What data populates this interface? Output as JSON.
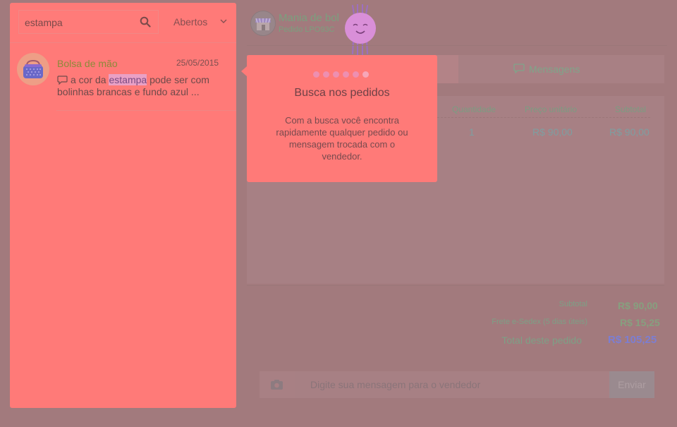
{
  "search": {
    "value": "estampa",
    "icon": "search-icon"
  },
  "filter": {
    "selected": "Abertos",
    "icon": "chevron-down-icon"
  },
  "orders": [
    {
      "title": "Bolsa de mão",
      "date": "25/05/2015",
      "message_before": "a cor da ",
      "message_highlight": "estampa",
      "message_after": " pode ser com bolinhas brancas e fundo azul  ..."
    }
  ],
  "shop": {
    "name": "Mania de bol",
    "order_code": "Pedido LPO93C"
  },
  "tabs": {
    "messages": "Mensagens"
  },
  "table": {
    "headers": [
      "Quantidade",
      "Preço unitário",
      "Subtotal"
    ],
    "row": [
      "1",
      "R$ 90,00",
      "R$ 90,00"
    ]
  },
  "summary": {
    "subtotal_label": "Subtotal",
    "subtotal_value": "R$ 90,00",
    "shipping_label": "Frete e-Sedex (5 dias úteis)",
    "shipping_value": "R$ 15,25",
    "total_label": "Total deste pedido",
    "total_value": "R$ 105,25"
  },
  "composer": {
    "placeholder": "Digite sua mensagem para o vendedor",
    "send_label": "Enviar"
  },
  "tooltip": {
    "title": "Busca nos pedidos",
    "body": "Com a busca você encontra rapidamente qualquer pedido ou mensagem trocada com o vendedor.",
    "steps_total": 6,
    "steps_done": 5
  },
  "colors": {
    "panel": "#ff7a78",
    "backdrop": "#a27a7d",
    "accent_green": "#7aa07e",
    "total_blue": "#7c7ed2"
  }
}
